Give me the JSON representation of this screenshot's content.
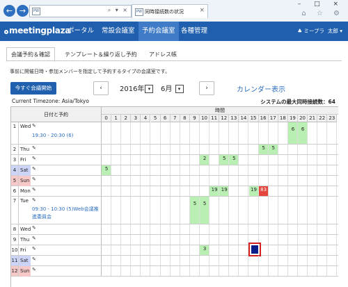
{
  "browser": {
    "back_icon": "arrow-left-icon",
    "forward_icon": "arrow-right-icon",
    "address_favicon": "PW",
    "address_controls": "⌕ ▾ ×",
    "tab_title": "同時接続数の状況",
    "tab_favicon": "PW",
    "tab_close": "×",
    "window_controls": "– □ ×",
    "toolbar_icons": "⌂ ☆ ⚙"
  },
  "app": {
    "logo": "meetingplaza",
    "nav": [
      "ポータル",
      "常設会議室",
      "予約会議室",
      "各種管理"
    ],
    "active_nav": 2,
    "user_icon": "♣",
    "user_group": "ミープラ",
    "user_name": "太郎 ▾",
    "accent": "#1f5fae"
  },
  "tabs": [
    "会議予約＆確認",
    "テンプレート＆繰り返し予約",
    "アドレス帳"
  ],
  "description": "事前に開催日時・参加メンバーを指定して予約するタイプの会議室です。",
  "controls": {
    "start_now": "今すぐ会議開始",
    "prev": "‹",
    "next": "›",
    "year": "2016年",
    "month": "6月",
    "dropdown_arrow": "▾",
    "calendar_link": "カレンダー表示"
  },
  "timezone": "Current Timezone: Asia/Tokyo",
  "max_connections": "システムの最大同時接続数：64",
  "grid": {
    "date_header": "日付と予約",
    "time_header": "時間",
    "hours": [
      "0",
      "1",
      "2",
      "3",
      "4",
      "5",
      "6",
      "7",
      "8",
      "9",
      "10",
      "11",
      "12",
      "13",
      "14",
      "15",
      "16",
      "17",
      "18",
      "19",
      "20",
      "21",
      "22",
      "23"
    ],
    "edit_icon": "✎",
    "rows": [
      {
        "num": "1",
        "day": "Wed",
        "type": "",
        "meeting": "19:30 - 20:30 (6)",
        "h": 32,
        "counts": {
          "19": "6",
          "20": "6"
        }
      },
      {
        "num": "2",
        "day": "Thu",
        "type": "",
        "meeting": "",
        "h": 15,
        "counts": {
          "16": "5",
          "17": "5"
        }
      },
      {
        "num": "3",
        "day": "Fri",
        "type": "",
        "meeting": "",
        "h": 15,
        "counts": {
          "10": "2",
          "12": "5",
          "13": "5"
        }
      },
      {
        "num": "4",
        "day": "Sat",
        "type": "sat",
        "meeting": "",
        "h": 15,
        "counts": {
          "0": "5"
        }
      },
      {
        "num": "5",
        "day": "Sun",
        "type": "sun",
        "meeting": "",
        "h": 15,
        "counts": {}
      },
      {
        "num": "6",
        "day": "Mon",
        "type": "",
        "meeting": "",
        "h": 15,
        "counts": {
          "11": "19",
          "12": "19",
          "15": "19",
          "16": "83"
        },
        "red": [
          "16"
        ]
      },
      {
        "num": "7",
        "day": "Tue",
        "type": "",
        "meeting": "09:30 - 10:30 (5)Web会議推進委員会",
        "h": 40,
        "counts": {
          "9": "5",
          "10": "5"
        }
      },
      {
        "num": "8",
        "day": "Wed",
        "type": "",
        "meeting": "",
        "h": 15,
        "counts": {}
      },
      {
        "num": "9",
        "day": "Thu",
        "type": "",
        "meeting": "",
        "h": 15,
        "counts": {}
      },
      {
        "num": "10",
        "day": "Fri",
        "type": "",
        "meeting": "",
        "h": 15,
        "counts": {
          "10": "3"
        }
      },
      {
        "num": "11",
        "day": "Sat",
        "type": "sat",
        "meeting": "",
        "h": 15,
        "counts": {}
      },
      {
        "num": "12",
        "day": "Sun",
        "type": "sun",
        "meeting": "",
        "h": 15,
        "counts": {}
      }
    ],
    "selected": {
      "row": 9,
      "hour": 15,
      "color": "#0a1e8a"
    }
  }
}
